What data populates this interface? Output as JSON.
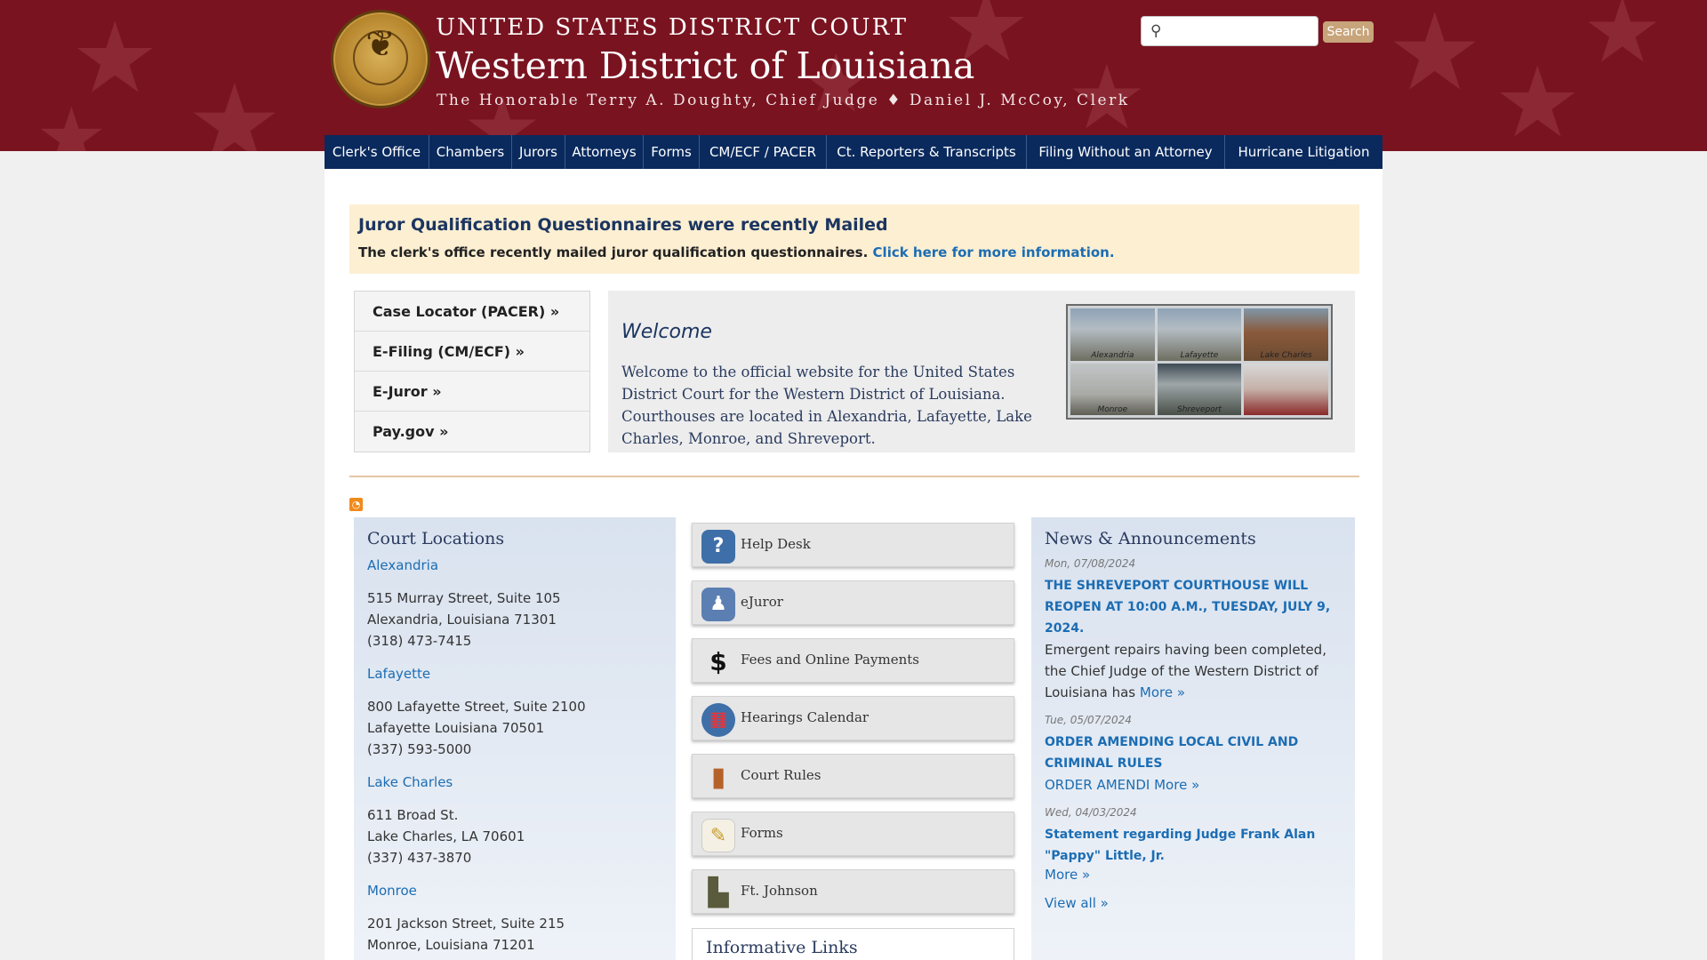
{
  "header": {
    "court_name": "UNITED STATES DISTRICT COURT",
    "district": "Western District of Louisiana",
    "judges": "The Honorable Terry A. Doughty, Chief Judge ♦ Daniel J. McCoy, Clerk",
    "seal_icon": "eagle-seal-icon",
    "search_placeholder": "",
    "search_button": "Search",
    "colors": {
      "banner": "#7a1320",
      "nav": "#0a2a5e",
      "accent": "#c7a47a"
    }
  },
  "nav": [
    {
      "label": "Clerk's Office"
    },
    {
      "label": "Chambers"
    },
    {
      "label": "Jurors"
    },
    {
      "label": "Attorneys"
    },
    {
      "label": "Forms"
    },
    {
      "label": "CM/ECF / PACER"
    },
    {
      "label": "Ct. Reporters & Transcripts"
    },
    {
      "label": "Filing Without an Attorney"
    },
    {
      "label": "Hurricane Litigation"
    }
  ],
  "alert": {
    "title": "Juror Qualification Questionnaires were recently Mailed",
    "body": "The clerk's office recently mailed juror qualification questionnaires.",
    "link": "Click here for more information."
  },
  "quick_links": [
    {
      "label": "Case Locator (PACER) »"
    },
    {
      "label": "E-Filing (CM/ECF) »"
    },
    {
      "label": "E-Juror »"
    },
    {
      "label": "Pay.gov »"
    }
  ],
  "welcome": {
    "title": "Welcome",
    "body": "Welcome to the official website for the United States District Court for the Western District of Louisiana.  Courthouses are located in Alexandria, Lafayette, Lake Charles, Monroe, and Shreveport.",
    "photos": [
      "Alexandria",
      "Lafayette",
      "Lake Charles",
      "Monroe",
      "Shreveport",
      ""
    ]
  },
  "locations": {
    "title": "Court Locations",
    "items": [
      {
        "name": "Alexandria",
        "line1": "515 Murray Street, Suite 105",
        "line2": "Alexandria, Louisiana 71301",
        "phone": "(318) 473-7415"
      },
      {
        "name": "Lafayette",
        "line1": "800 Lafayette Street, Suite 2100",
        "line2": "Lafayette Louisiana 70501",
        "phone": "(337) 593-5000"
      },
      {
        "name": "Lake Charles",
        "line1": "611 Broad St.",
        "line2": "Lake Charles, LA 70601",
        "phone": "(337) 437-3870"
      },
      {
        "name": "Monroe",
        "line1": "201 Jackson Street, Suite 215",
        "line2": "Monroe, Louisiana 71201",
        "phone": ""
      }
    ]
  },
  "links": [
    {
      "label": "Help Desk",
      "icon": "help-desk-icon",
      "glyph": "?"
    },
    {
      "label": "eJuror",
      "icon": "ejuror-icon",
      "glyph": "♟"
    },
    {
      "label": "Fees and Online Payments",
      "icon": "dollar-icon",
      "glyph": "$"
    },
    {
      "label": "Hearings Calendar",
      "icon": "calendar-icon",
      "glyph": "▦"
    },
    {
      "label": "Court Rules",
      "icon": "book-icon",
      "glyph": "▮"
    },
    {
      "label": "Forms",
      "icon": "forms-icon",
      "glyph": "✎"
    },
    {
      "label": "Ft. Johnson",
      "icon": "building-icon",
      "glyph": "▙"
    }
  ],
  "informative": {
    "title": "Informative Links"
  },
  "news": {
    "title": "News & Announcements",
    "items": [
      {
        "date": "Mon, 07/08/2024",
        "title": "THE SHREVEPORT COURTHOUSE WILL REOPEN AT 10:00 A.M., TUESDAY, JULY 9, 2024.",
        "body": "Emergent repairs having been completed, the Chief Judge of the Western District of Louisiana has",
        "more": "More »"
      },
      {
        "date": "Tue, 05/07/2024",
        "title": "ORDER AMENDING LOCAL CIVIL AND CRIMINAL RULES",
        "body": "ORDER AMENDI",
        "more": "More »"
      },
      {
        "date": "Wed, 04/03/2024",
        "title": "Statement regarding Judge Frank Alan \"Pappy\" Little, Jr.",
        "body": "",
        "more": "More »"
      }
    ],
    "view_all": "View all »"
  },
  "rss_icon": "rss-icon"
}
